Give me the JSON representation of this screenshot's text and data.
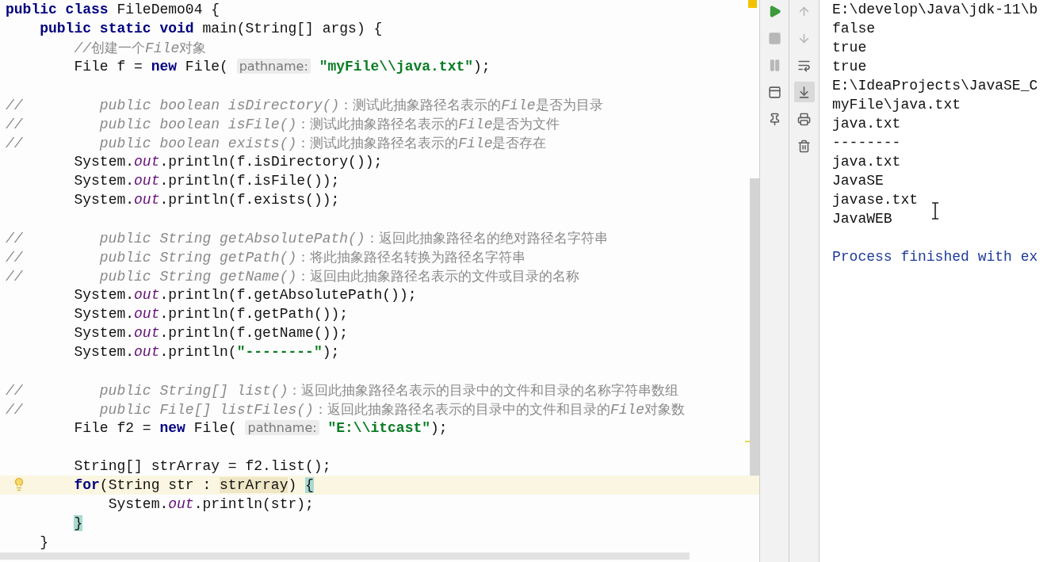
{
  "editor": {
    "lines": [
      {
        "highlighted": false,
        "tokens": [
          {
            "kind": "kw",
            "text": "public class"
          },
          {
            "kind": "plain",
            "text": " FileDemo04 {"
          }
        ]
      },
      {
        "highlighted": false,
        "tokens": [
          {
            "kind": "kw",
            "text": "    public static void"
          },
          {
            "kind": "plain",
            "text": " main(String[] args) {"
          }
        ]
      },
      {
        "highlighted": false,
        "tokens": [
          {
            "kind": "comment",
            "text": "        //"
          },
          {
            "kind": "note",
            "text": "创建一个"
          },
          {
            "kind": "comment",
            "text": "File"
          },
          {
            "kind": "note",
            "text": "对象"
          }
        ]
      },
      {
        "highlighted": false,
        "tokens": [
          {
            "kind": "plain",
            "text": "        File f = "
          },
          {
            "kind": "kw",
            "text": "new"
          },
          {
            "kind": "plain",
            "text": " File( "
          },
          {
            "kind": "hint",
            "text": "pathname:"
          },
          {
            "kind": "str",
            "text": " \"myFile\\\\java.txt\""
          },
          {
            "kind": "plain",
            "text": ");"
          }
        ]
      },
      {
        "highlighted": false
      },
      {
        "highlighted": false,
        "tokens": [
          {
            "kind": "comment",
            "text": "//         public boolean isDirectory()"
          },
          {
            "kind": "note",
            "text": "：测试此抽象路径名表示的"
          },
          {
            "kind": "comment",
            "text": "File"
          },
          {
            "kind": "note",
            "text": "是否为目录"
          }
        ]
      },
      {
        "highlighted": false,
        "tokens": [
          {
            "kind": "comment",
            "text": "//         public boolean isFile()"
          },
          {
            "kind": "note",
            "text": "：测试此抽象路径名表示的"
          },
          {
            "kind": "comment",
            "text": "File"
          },
          {
            "kind": "note",
            "text": "是否为文件"
          }
        ]
      },
      {
        "highlighted": false,
        "tokens": [
          {
            "kind": "comment",
            "text": "//         public boolean exists()"
          },
          {
            "kind": "note",
            "text": "：测试此抽象路径名表示的"
          },
          {
            "kind": "comment",
            "text": "File"
          },
          {
            "kind": "note",
            "text": "是否存在"
          }
        ]
      },
      {
        "highlighted": false,
        "tokens": [
          {
            "kind": "plain",
            "text": "        System."
          },
          {
            "kind": "static",
            "text": "out"
          },
          {
            "kind": "plain",
            "text": ".println(f.isDirectory());"
          }
        ]
      },
      {
        "highlighted": false,
        "tokens": [
          {
            "kind": "plain",
            "text": "        System."
          },
          {
            "kind": "static",
            "text": "out"
          },
          {
            "kind": "plain",
            "text": ".println(f.isFile());"
          }
        ]
      },
      {
        "highlighted": false,
        "tokens": [
          {
            "kind": "plain",
            "text": "        System."
          },
          {
            "kind": "static",
            "text": "out"
          },
          {
            "kind": "plain",
            "text": ".println(f.exists());"
          }
        ]
      },
      {
        "highlighted": false
      },
      {
        "highlighted": false,
        "tokens": [
          {
            "kind": "comment",
            "text": "//         public String getAbsolutePath()"
          },
          {
            "kind": "note",
            "text": "：返回此抽象路径名的绝对路径名字符串"
          }
        ]
      },
      {
        "highlighted": false,
        "tokens": [
          {
            "kind": "comment",
            "text": "//         public String getPath()"
          },
          {
            "kind": "note",
            "text": "：将此抽象路径名转换为路径名字符串"
          }
        ]
      },
      {
        "highlighted": false,
        "tokens": [
          {
            "kind": "comment",
            "text": "//         public String getName()"
          },
          {
            "kind": "note",
            "text": "：返回由此抽象路径名表示的文件或目录的名称"
          }
        ]
      },
      {
        "highlighted": false,
        "tokens": [
          {
            "kind": "plain",
            "text": "        System."
          },
          {
            "kind": "static",
            "text": "out"
          },
          {
            "kind": "plain",
            "text": ".println(f.getAbsolutePath());"
          }
        ]
      },
      {
        "highlighted": false,
        "tokens": [
          {
            "kind": "plain",
            "text": "        System."
          },
          {
            "kind": "static",
            "text": "out"
          },
          {
            "kind": "plain",
            "text": ".println(f.getPath());"
          }
        ]
      },
      {
        "highlighted": false,
        "tokens": [
          {
            "kind": "plain",
            "text": "        System."
          },
          {
            "kind": "static",
            "text": "out"
          },
          {
            "kind": "plain",
            "text": ".println(f.getName());"
          }
        ]
      },
      {
        "highlighted": false,
        "tokens": [
          {
            "kind": "plain",
            "text": "        System."
          },
          {
            "kind": "static",
            "text": "out"
          },
          {
            "kind": "plain",
            "text": ".println("
          },
          {
            "kind": "str",
            "text": "\"--------\""
          },
          {
            "kind": "plain",
            "text": ");"
          }
        ]
      },
      {
        "highlighted": false
      },
      {
        "highlighted": false,
        "tokens": [
          {
            "kind": "comment",
            "text": "//         public String[] list()"
          },
          {
            "kind": "note",
            "text": "：返回此抽象路径名表示的目录中的文件和目录的名称字符串数组"
          }
        ]
      },
      {
        "highlighted": false,
        "tokens": [
          {
            "kind": "comment",
            "text": "//         public File[] listFiles()"
          },
          {
            "kind": "note",
            "text": "：返回此抽象路径名表示的目录中的文件和目录的"
          },
          {
            "kind": "comment",
            "text": "File"
          },
          {
            "kind": "note",
            "text": "对象数"
          }
        ]
      },
      {
        "highlighted": false,
        "tokens": [
          {
            "kind": "plain",
            "text": "        File f2 = "
          },
          {
            "kind": "kw",
            "text": "new"
          },
          {
            "kind": "plain",
            "text": " File( "
          },
          {
            "kind": "hint",
            "text": "pathname:"
          },
          {
            "kind": "str",
            "text": " \"E:\\\\itcast\""
          },
          {
            "kind": "plain",
            "text": ");"
          }
        ]
      },
      {
        "highlighted": false
      },
      {
        "highlighted": false,
        "tokens": [
          {
            "kind": "plain",
            "text": "        String[] strArray = f2.list();"
          }
        ]
      },
      {
        "highlighted": true,
        "tokens": [
          {
            "kind": "kw",
            "text": "        for"
          },
          {
            "kind": "plain",
            "text": "(String str : "
          },
          {
            "kind": "mark",
            "text": "strArray"
          },
          {
            "kind": "plain",
            "text": ") "
          },
          {
            "kind": "brace",
            "text": "{"
          }
        ]
      },
      {
        "highlighted": false,
        "tokens": [
          {
            "kind": "plain",
            "text": "            System."
          },
          {
            "kind": "static",
            "text": "out"
          },
          {
            "kind": "plain",
            "text": ".println(str);"
          }
        ]
      },
      {
        "highlighted": false,
        "tokens": [
          {
            "kind": "brace",
            "text": "        }"
          }
        ]
      },
      {
        "highlighted": false,
        "tokens": [
          {
            "kind": "plain",
            "text": "    }"
          }
        ]
      }
    ]
  },
  "run_toolbar": [
    {
      "kind": "run",
      "disabled": false
    },
    {
      "kind": "stop",
      "disabled": true
    },
    {
      "kind": "pause",
      "disabled": true
    },
    {
      "kind": "layout",
      "disabled": false
    },
    {
      "kind": "pin",
      "disabled": false
    }
  ],
  "console_toolbar": [
    {
      "kind": "up",
      "disabled": true,
      "selected": false
    },
    {
      "kind": "down",
      "disabled": true,
      "selected": false
    },
    {
      "kind": "wrap",
      "disabled": false,
      "selected": false
    },
    {
      "kind": "scroll-end",
      "disabled": false,
      "selected": true
    },
    {
      "kind": "print",
      "disabled": false,
      "selected": false
    },
    {
      "kind": "trash",
      "disabled": false,
      "selected": false
    }
  ],
  "console": [
    {
      "kind": "output",
      "text": "E:\\develop\\Java\\jdk-11\\b"
    },
    {
      "kind": "output",
      "text": "false"
    },
    {
      "kind": "output",
      "text": "true"
    },
    {
      "kind": "output",
      "text": "true"
    },
    {
      "kind": "output",
      "text": "E:\\IdeaProjects\\JavaSE_C"
    },
    {
      "kind": "output",
      "text": "myFile\\java.txt"
    },
    {
      "kind": "output",
      "text": "java.txt"
    },
    {
      "kind": "output",
      "text": "--------"
    },
    {
      "kind": "output",
      "text": "java.txt"
    },
    {
      "kind": "output",
      "text": "JavaSE"
    },
    {
      "kind": "output",
      "text": "javase.txt"
    },
    {
      "kind": "output",
      "text": "JavaWEB"
    },
    {
      "kind": "exit",
      "text": "Process finished with ex"
    }
  ]
}
